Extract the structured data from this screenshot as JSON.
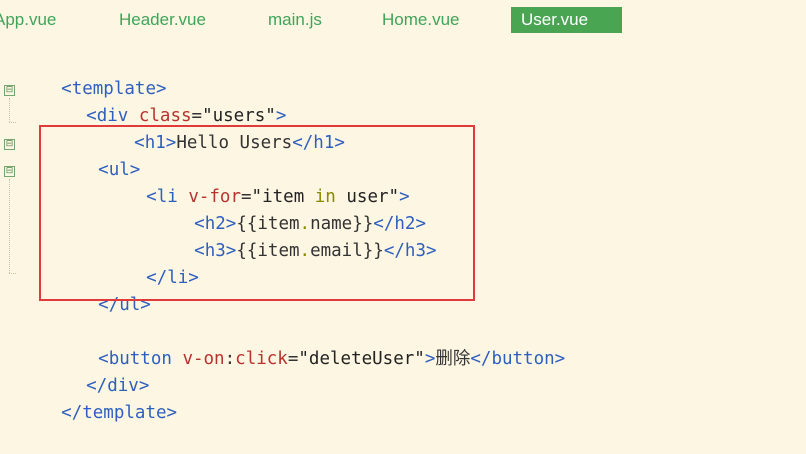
{
  "tabs": [
    {
      "label": "App.vue",
      "active": false
    },
    {
      "label": "Header.vue",
      "active": false
    },
    {
      "label": "main.js",
      "active": false
    },
    {
      "label": "Home.vue",
      "active": false
    },
    {
      "label": "User.vue",
      "active": true
    }
  ],
  "code": {
    "l1": {
      "open": "<template>"
    },
    "l2": {
      "open": "<div ",
      "attr": "class",
      "eq": "=",
      "val": "\"users\"",
      "close": ">"
    },
    "l3": {
      "open": "<h1>",
      "text": "Hello Users",
      "close": "</h1>"
    },
    "l4": {
      "open": "<ul>"
    },
    "l5": {
      "open": "<li ",
      "attr": "v-for",
      "eq": "=",
      "q1": "\"item ",
      "kw": "in",
      "q2": " user\"",
      "close": ">"
    },
    "l6": {
      "open": "<h2>",
      "t1": "{{item",
      "dot": ".",
      "t2": "name}}",
      "close": "</h2>"
    },
    "l7": {
      "open": "<h3>",
      "t1": "{{item",
      "dot": ".",
      "t2": "email}}",
      "close": "</h3>"
    },
    "l8": {
      "open": "</li>"
    },
    "l9": {
      "open": "</ul>"
    },
    "l10": {
      "open": "<button ",
      "attr": "v-on",
      "colon": ":",
      "attr2": "click",
      "eq": "=",
      "val": "\"deleteUser\"",
      "gt": ">",
      "text": "删除",
      "close": "</button>"
    },
    "l11": {
      "open": "</div>"
    },
    "l12": {
      "open": "</template>"
    }
  },
  "fold_marker": "⊟",
  "colors": {
    "tab_text": "#3fa45a",
    "tab_active_bg": "#4aa553",
    "tag": "#2e5fbf",
    "attr": "#b8322e",
    "highlight_border": "#e03a3a",
    "background": "#fdf6e3"
  }
}
